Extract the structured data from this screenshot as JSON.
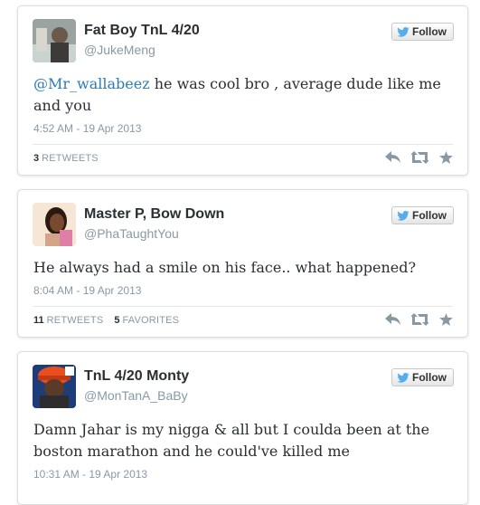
{
  "follow_label": "Follow",
  "tweets": [
    {
      "name": "Fat Boy TnL 4/20",
      "handle": "@JukeMeng",
      "mention": "@Mr_wallabeez",
      "text": " he was cool bro , average dude like me and you",
      "timestamp": "4:52 AM - 19 Apr 2013",
      "retweets_count": "3",
      "retweets_label": "RETWEETS",
      "favorites_count": "",
      "favorites_label": ""
    },
    {
      "name": "Master P, Bow Down",
      "handle": "@PhaTaughtYou",
      "mention": "",
      "text": "He always had a smile on his face.. what happened?",
      "timestamp": "8:04 AM - 19 Apr 2013",
      "retweets_count": "11",
      "retweets_label": "RETWEETS",
      "favorites_count": "5",
      "favorites_label": "FAVORITES"
    },
    {
      "name": "TnL 4/20 Monty",
      "handle": "@MonTanA_BaBy",
      "mention": "",
      "text": "Damn Jahar is my nigga & all but I coulda been at the boston marathon and he could've killed me",
      "timestamp": "10:31 AM - 19 Apr 2013"
    }
  ],
  "colors": {
    "link": "#2b7bb9",
    "muted": "#8899a6",
    "twitter_bird": "#55acee"
  },
  "icons": [
    "twitter-bird-icon",
    "reply-icon",
    "retweet-icon",
    "favorite-star-icon"
  ]
}
